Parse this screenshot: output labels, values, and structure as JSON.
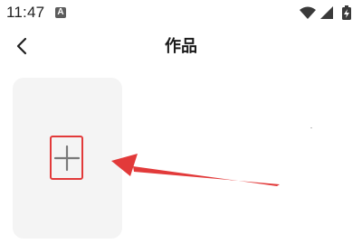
{
  "status_bar": {
    "time": "11:47",
    "app_badge": "A",
    "icons": [
      "wifi-icon",
      "signal-icon",
      "battery-charging-icon"
    ]
  },
  "header": {
    "back_icon": "back-chevron-icon",
    "title": "作品"
  },
  "works": {
    "add_card_icon": "plus-icon"
  },
  "colors": {
    "highlight": "#e23a3a",
    "card_background": "#f4f4f4",
    "icon_gray": "#7a7a7a"
  }
}
